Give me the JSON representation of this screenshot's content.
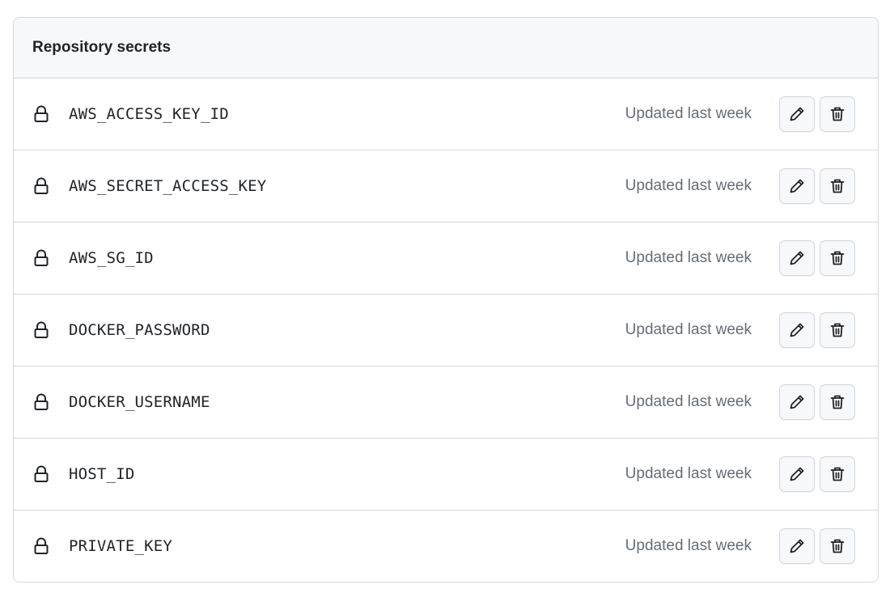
{
  "panel": {
    "title": "Repository secrets"
  },
  "secrets": [
    {
      "name": "AWS_ACCESS_KEY_ID",
      "updated": "Updated last week"
    },
    {
      "name": "AWS_SECRET_ACCESS_KEY",
      "updated": "Updated last week"
    },
    {
      "name": "AWS_SG_ID",
      "updated": "Updated last week"
    },
    {
      "name": "DOCKER_PASSWORD",
      "updated": "Updated last week"
    },
    {
      "name": "DOCKER_USERNAME",
      "updated": "Updated last week"
    },
    {
      "name": "HOST_ID",
      "updated": "Updated last week"
    },
    {
      "name": "PRIVATE_KEY",
      "updated": "Updated last week"
    }
  ],
  "icons": {
    "row_icon": "lock-icon",
    "edit_icon": "pencil-icon",
    "delete_icon": "trash-icon"
  },
  "colors": {
    "border": "#d0d7de",
    "header_bg": "#f6f8fa",
    "muted_text": "#656d76",
    "text": "#1f2328"
  }
}
